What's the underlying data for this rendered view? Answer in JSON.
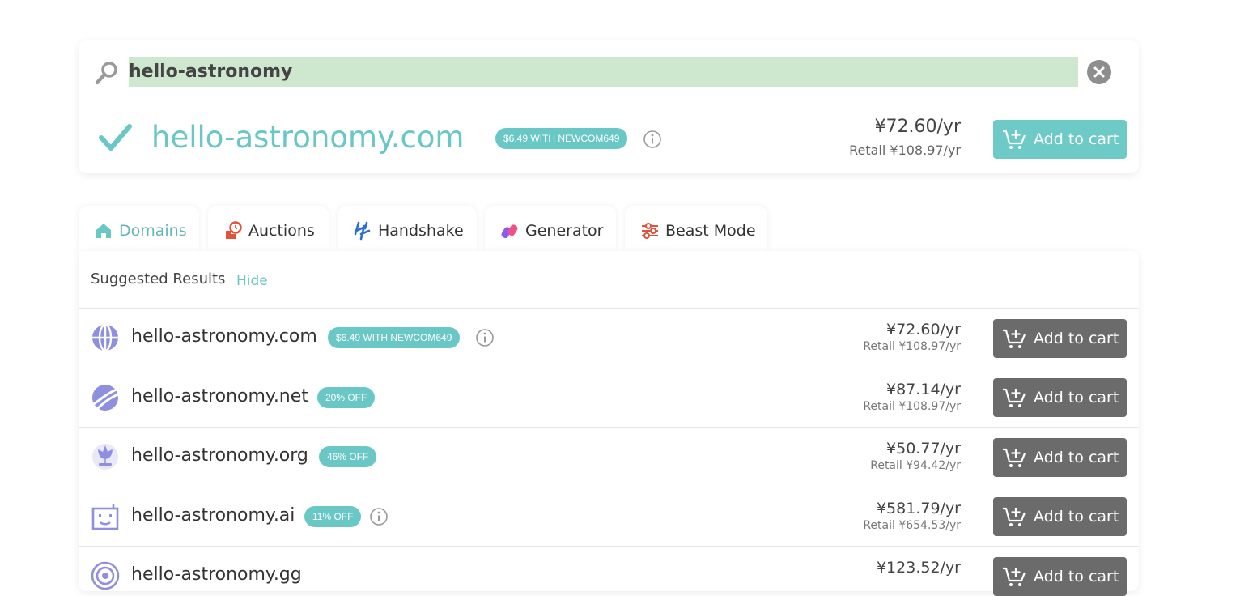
{
  "search": {
    "query": "hello-astronomy"
  },
  "hero": {
    "domain": "hello-astronomy.com",
    "badge": "$6.49 WITH NEWCOM649",
    "price": "¥72.60/yr",
    "retail": "Retail ¥108.97/yr",
    "button": "Add to cart"
  },
  "tabs": [
    {
      "label": "Domains",
      "icon": "home-icon",
      "active": true
    },
    {
      "label": "Auctions",
      "icon": "auction-clock-icon"
    },
    {
      "label": "Handshake",
      "icon": "handshake-icon"
    },
    {
      "label": "Generator",
      "icon": "generator-icon"
    },
    {
      "label": "Beast Mode",
      "icon": "sliders-icon"
    }
  ],
  "results": {
    "header": "Suggested Results",
    "hide": "Hide",
    "rows": [
      {
        "domain": "hello-astronomy.com",
        "badge": "$6.49 WITH NEWCOM649",
        "price": "¥72.60/yr",
        "retail": "Retail ¥108.97/yr",
        "button": "Add to cart",
        "icon": "globe-icon"
      },
      {
        "domain": "hello-astronomy.net",
        "badge": "20% OFF",
        "price": "¥87.14/yr",
        "retail": "Retail ¥108.97/yr",
        "button": "Add to cart",
        "icon": "net-planet-icon"
      },
      {
        "domain": "hello-astronomy.org",
        "badge": "46% OFF",
        "price": "¥50.77/yr",
        "retail": "Retail ¥94.42/yr",
        "button": "Add to cart",
        "icon": "org-plant-icon"
      },
      {
        "domain": "hello-astronomy.ai",
        "badge": "11% OFF",
        "price": "¥581.79/yr",
        "retail": "Retail ¥654.53/yr",
        "button": "Add to cart",
        "icon": "robot-icon"
      },
      {
        "domain": "hello-astronomy.gg",
        "badge": "",
        "price": "¥123.52/yr",
        "retail": "",
        "button": "Add to cart",
        "icon": "target-icon"
      }
    ]
  },
  "colors": {
    "accent": "#69c7c5",
    "search_highlight": "#cde8cf",
    "button_gray": "#6b6b6b",
    "icon_purple": "#8f8fe0"
  }
}
